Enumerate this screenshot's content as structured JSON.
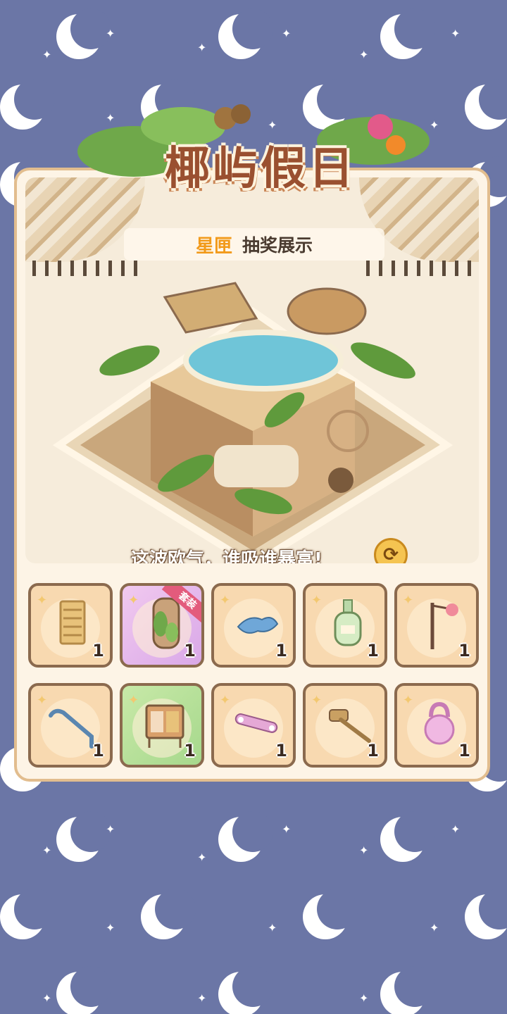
{
  "event": {
    "title": "椰屿假日",
    "brand": "星匣",
    "subtitle": "抽奖展示",
    "tagline": "这波欧气，谁吸谁暴富!"
  },
  "colors": {
    "background": "#6b76a6",
    "card": "#fdf4e6",
    "slot": "#f8d9b0",
    "rare_slot": "#d9a8e8",
    "uncommon_slot": "#a6d88c",
    "brand": "#f29a1a"
  },
  "rewards": [
    {
      "icon": "wooden-shutter-icon",
      "count": "1",
      "rarity": "common"
    },
    {
      "icon": "jungle-wardrobe-icon",
      "count": "1",
      "rarity": "rare",
      "badge": "套装"
    },
    {
      "icon": "blue-mat-icon",
      "count": "1",
      "rarity": "common"
    },
    {
      "icon": "glass-bottle-icon",
      "count": "1",
      "rarity": "common"
    },
    {
      "icon": "flamingo-lamp-icon",
      "count": "1",
      "rarity": "common"
    },
    {
      "icon": "towel-rail-icon",
      "count": "1",
      "rarity": "common"
    },
    {
      "icon": "wooden-cabinet-icon",
      "count": "1",
      "rarity": "uncommon"
    },
    {
      "icon": "pink-strap-icon",
      "count": "1",
      "rarity": "common"
    },
    {
      "icon": "wooden-mallet-icon",
      "count": "1",
      "rarity": "common"
    },
    {
      "icon": "pink-kettlebell-icon",
      "count": "1",
      "rarity": "common"
    }
  ]
}
